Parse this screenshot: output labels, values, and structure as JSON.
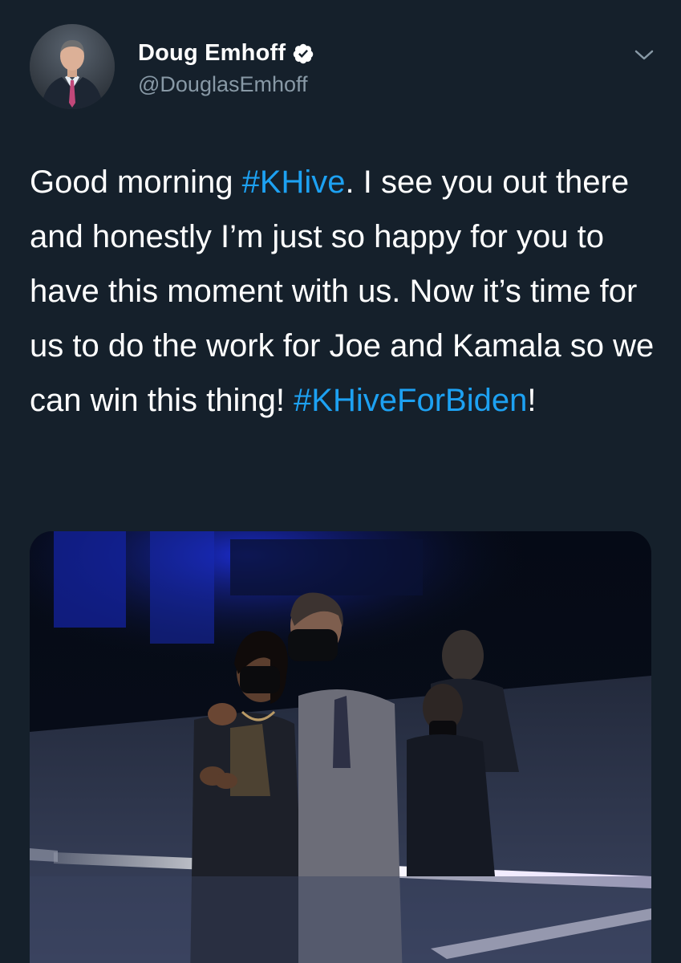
{
  "tweet": {
    "author": {
      "display_name": "Doug Emhoff",
      "handle": "@DouglasEmhoff",
      "verified": true,
      "verified_badge_icon": "verified-badge-icon"
    },
    "menu_icon": "chevron-down-icon",
    "text": {
      "p1": "Good morning ",
      "tag1": "#KHive",
      "p2": ". I see you out there and honestly I’m just so happy for you to have this moment with us. Now it’s time for us to do the work for Joe and Kamala so we can win this thing! ",
      "tag2": "#KHiveForBiden",
      "p3": "!"
    },
    "colors": {
      "background": "#15202b",
      "text": "#ffffff",
      "secondary_text": "#8899a6",
      "link": "#1da1f2"
    }
  }
}
